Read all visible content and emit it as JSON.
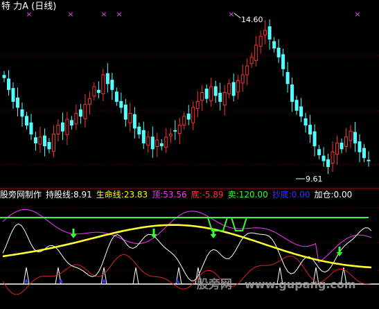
{
  "title": "特 力A (日线)",
  "price_panel": {
    "high_label": "14.60",
    "low_label": "9.61",
    "high_value": 14.6,
    "low_value": 9.61,
    "colors": {
      "up": "#ff3333",
      "down": "#54ffff",
      "mark": "#ff33ff",
      "grid": "#550000"
    }
  },
  "indicator_bar": {
    "name": "股旁网制作",
    "items": [
      {
        "label": "持股线:",
        "value": "8.91",
        "color": "#ffffff"
      },
      {
        "label": "生命线:",
        "value": "23.83",
        "color": "#ffff00"
      },
      {
        "label": "顶:",
        "value": "53.56",
        "color": "#ff33ff"
      },
      {
        "label": "底:",
        "value": "-5.89",
        "color": "#ff3333"
      },
      {
        "label": "卖:",
        "value": "120.00",
        "color": "#33ff33"
      },
      {
        "label": "抄底:",
        "value": "0.00",
        "color": "#3333ff"
      },
      {
        "label": "加仓:",
        "value": "0.00",
        "color": "#ffffff"
      }
    ]
  },
  "watermark": {
    "cn": "股旁网",
    "url": "www.gupang.com"
  },
  "chart_data": [
    {
      "type": "candlestick",
      "title": "特 力A (日线)",
      "annotations": [
        {
          "text": "14.60",
          "kind": "period-high"
        },
        {
          "text": "9.61",
          "kind": "period-low"
        }
      ],
      "ylim": [
        9.3,
        15.0
      ],
      "closes": [
        12.8,
        12.4,
        12.0,
        11.8,
        11.5,
        11.2,
        10.9,
        10.6,
        10.8,
        10.5,
        10.4,
        10.9,
        11.2,
        11.0,
        11.4,
        11.2,
        11.6,
        11.5,
        11.9,
        12.1,
        12.5,
        12.3,
        12.9,
        12.6,
        12.4,
        12.0,
        11.8,
        11.4,
        11.6,
        11.1,
        10.9,
        10.6,
        10.8,
        10.4,
        10.7,
        10.5,
        10.8,
        10.9,
        11.0,
        11.2,
        11.5,
        11.4,
        11.8,
        12.0,
        12.3,
        12.1,
        12.5,
        12.2,
        12.0,
        12.3,
        12.6,
        12.2,
        12.7,
        12.9,
        13.2,
        13.5,
        13.9,
        14.2,
        14.4,
        14.1,
        13.8,
        13.5,
        13.1,
        12.6,
        12.0,
        11.7,
        11.5,
        11.2,
        10.9,
        10.5,
        10.2,
        10.0,
        9.8,
        10.3,
        10.6,
        10.4,
        10.8,
        11.0,
        10.6,
        10.3,
        10.1,
        10.0
      ]
    },
    {
      "type": "line",
      "series": [
        {
          "name": "持股线",
          "color": "#ffffff"
        },
        {
          "name": "生命线",
          "color": "#ffff00"
        },
        {
          "name": "顶",
          "color": "#ff33ff"
        },
        {
          "name": "底",
          "color": "#ff3333"
        },
        {
          "name": "卖",
          "color": "#33ff33"
        },
        {
          "name": "抄底",
          "color": "#3333ff"
        }
      ],
      "values": {
        "持股线": 8.91,
        "生命线": 23.83,
        "顶": 53.56,
        "底": -5.89,
        "卖": 120.0,
        "抄底": 0.0,
        "加仓": 0.0
      }
    }
  ]
}
